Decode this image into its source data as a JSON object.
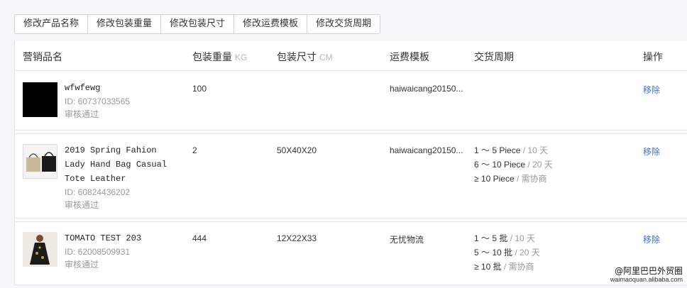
{
  "toolbar": {
    "buttons": [
      "修改产品名称",
      "修改包装重量",
      "修改包装尺寸",
      "修改运费模板",
      "修改交货周期"
    ]
  },
  "table": {
    "headers": {
      "name": "营销品名",
      "weight": "包装重量",
      "weight_unit": "KG",
      "size": "包装尺寸",
      "size_unit": "CM",
      "template": "运费模板",
      "lead": "交货周期",
      "action": "操作"
    },
    "rows": [
      {
        "name_lines": [
          "wfwfewg"
        ],
        "id": "ID: 60737033565",
        "status": "审核通过",
        "weight": "100",
        "size": "",
        "template": "haiwaicang20150...",
        "lead": [],
        "action": "移除"
      },
      {
        "name_lines": [
          "2019 Spring Fahion",
          "Lady Hand Bag Casual",
          "Tote Leather"
        ],
        "id": "ID: 60824436202",
        "status": "审核通过",
        "weight": "2",
        "size": "50X40X20",
        "template": "haiwaicang20150...",
        "lead": [
          {
            "qty": "1 ～ 5 Piece",
            "sep": " / ",
            "dur": "10 天"
          },
          {
            "qty": "6 ～ 10 Piece",
            "sep": " / ",
            "dur": "20 天"
          },
          {
            "qty": "≥ 10 Piece",
            "sep": " / ",
            "dur": "需协商"
          }
        ],
        "action": "移除"
      },
      {
        "name_lines": [
          "TOMATO TEST 203"
        ],
        "id": "ID: 62008509931",
        "status": "审核通过",
        "weight": "444",
        "size": "12X22X33",
        "template": "无忧物流",
        "lead": [
          {
            "qty": "1 ～ 5 批",
            "sep": " / ",
            "dur": "10 天"
          },
          {
            "qty": "5 ～ 10 批",
            "sep": " / ",
            "dur": "20 天"
          },
          {
            "qty": "≥ 10 批",
            "sep": " / ",
            "dur": "需协商"
          }
        ],
        "action": "移除"
      }
    ]
  },
  "watermark": {
    "main": "@阿里巴巴外贸圈",
    "sub": "waimaoquan.alibaba.com"
  },
  "colors": {
    "link": "#3b6fd6",
    "muted": "#999999",
    "border": "#e3e5e8"
  }
}
